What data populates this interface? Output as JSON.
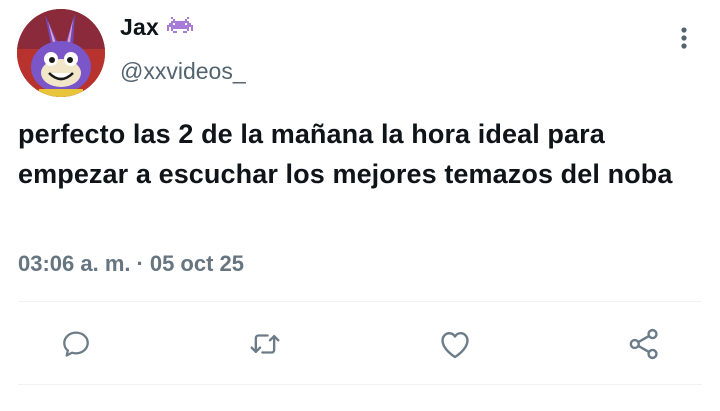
{
  "user": {
    "display_name": "Jax",
    "badge_icon": "alien-monster-emoji-icon",
    "handle": "@xxvideos_",
    "avatar_icon": "avatar-jax-character"
  },
  "tweet": {
    "text": "perfecto las 2 de la mañana la hora ideal para empezar a escuchar los mejores temazos del noba"
  },
  "meta": {
    "time": "03:06 a. m.",
    "separator": "·",
    "date": "05 oct 25"
  },
  "actions": [
    {
      "name": "reply",
      "icon": "comment-icon"
    },
    {
      "name": "retweet",
      "icon": "retweet-icon"
    },
    {
      "name": "like",
      "icon": "heart-icon"
    },
    {
      "name": "share",
      "icon": "share-icon"
    }
  ],
  "colors": {
    "text": "#0f1419",
    "secondary": "#536471",
    "icon": "#6b7c88",
    "badge": "#a87bd9",
    "divider": "#eff3f4"
  }
}
